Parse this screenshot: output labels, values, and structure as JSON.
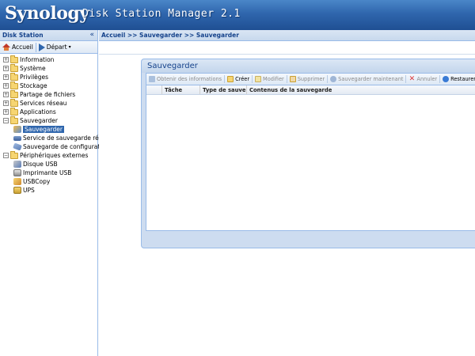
{
  "app": {
    "logo": "Synology",
    "product": "Disk Station Manager 2.1"
  },
  "left_panel": {
    "title": "Disk Station",
    "collapse_glyph": "«",
    "toolbar": {
      "home_label": "Accueil",
      "start_label": "Départ"
    },
    "tree": [
      {
        "label": "Information",
        "expandable": true
      },
      {
        "label": "Système",
        "expandable": true
      },
      {
        "label": "Privilèges",
        "expandable": true
      },
      {
        "label": "Stockage",
        "expandable": true
      },
      {
        "label": "Partage de fichiers",
        "expandable": true
      },
      {
        "label": "Services réseau",
        "expandable": true
      },
      {
        "label": "Applications",
        "expandable": true
      },
      {
        "label": "Sauvegarder",
        "expanded": true,
        "children": [
          {
            "label": "Sauvegarder",
            "selected": true,
            "icon": "backup-icon"
          },
          {
            "label": "Service de sauvegarde réseau",
            "icon": "network-backup-icon"
          },
          {
            "label": "Sauvegarde de configuration",
            "icon": "config-backup-icon"
          }
        ]
      },
      {
        "label": "Périphériques externes",
        "expanded": true,
        "children": [
          {
            "label": "Disque USB",
            "icon": "usb-disk-icon"
          },
          {
            "label": "Imprimante USB",
            "icon": "printer-icon"
          },
          {
            "label": "USBCopy",
            "icon": "usbcopy-icon"
          },
          {
            "label": "UPS",
            "icon": "ups-icon"
          }
        ]
      }
    ]
  },
  "breadcrumb": "Accueil >> Sauvegarder >> Sauvegarder",
  "window": {
    "title": "Sauvegarder",
    "toolbar": [
      {
        "label": "Obtenir des informations",
        "enabled": false
      },
      {
        "label": "Créer",
        "enabled": true
      },
      {
        "label": "Modifier",
        "enabled": false
      },
      {
        "label": "Supprimer",
        "enabled": false
      },
      {
        "label": "Sauvegarder maintenant",
        "enabled": false
      },
      {
        "label": "Annuler",
        "enabled": false
      },
      {
        "label": "Restaurer",
        "enabled": true
      }
    ],
    "columns": [
      "",
      "Tâche",
      "Type de sauve...",
      "Contenus de la sauvegarde"
    ]
  },
  "colors": {
    "banner": "#2f66ad",
    "header_text": "#15428b",
    "selection": "#2f66ad",
    "border": "#99bbe8"
  }
}
